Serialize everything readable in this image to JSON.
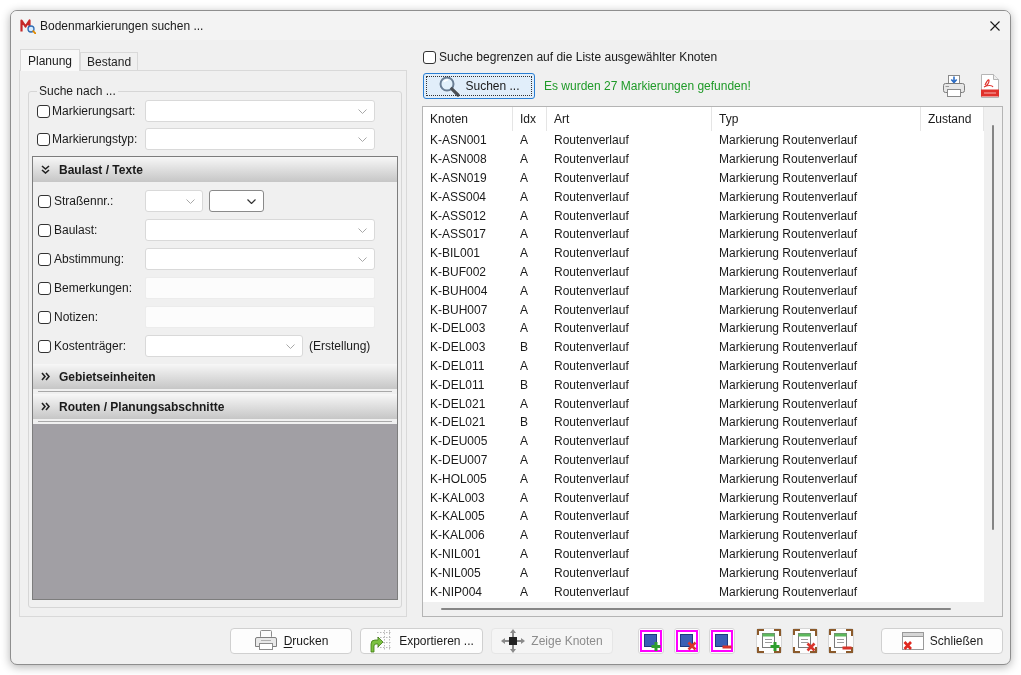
{
  "window": {
    "title": "Bodenmarkierungen suchen ..."
  },
  "tabs": [
    {
      "label": "Planung",
      "selected": true
    },
    {
      "label": "Bestand",
      "selected": false
    }
  ],
  "search_group": {
    "title": "Suche nach ...",
    "filters": [
      {
        "label": "Markierungsart:",
        "checked": false,
        "fields": [
          {
            "kind": "combo"
          }
        ]
      },
      {
        "label": "Markierungstyp:",
        "checked": false,
        "fields": [
          {
            "kind": "combo"
          }
        ]
      }
    ],
    "sections": [
      {
        "title": "Baulast / Texte",
        "expanded": true,
        "rows": [
          {
            "label": "Straßennr.:",
            "checked": false,
            "fields": [
              {
                "kind": "combo"
              },
              {
                "kind": "dropdown"
              }
            ]
          },
          {
            "label": "Baulast:",
            "checked": false,
            "fields": [
              {
                "kind": "combo"
              }
            ]
          },
          {
            "label": "Abstimmung:",
            "checked": false,
            "fields": [
              {
                "kind": "combo"
              }
            ]
          },
          {
            "label": "Bemerkungen:",
            "checked": false,
            "fields": [
              {
                "kind": "text"
              }
            ]
          },
          {
            "label": "Notizen:",
            "checked": false,
            "fields": [
              {
                "kind": "text"
              }
            ]
          },
          {
            "label": "Kostenträger:",
            "checked": false,
            "fields": [
              {
                "kind": "combo"
              }
            ],
            "note": "(Erstellung)"
          }
        ]
      },
      {
        "title": "Gebietseinheiten",
        "expanded": false
      },
      {
        "title": "Routen / Planungsabschnitte",
        "expanded": false
      }
    ]
  },
  "restrict_search": {
    "label": "Suche begrenzen auf die Liste ausgewählter Knoten",
    "checked": false
  },
  "search_button": {
    "label": "Suchen ...",
    "focused": true
  },
  "result_message": "Es wurden 27 Markierungen gefunden!",
  "table": {
    "columns": [
      "Knoten",
      "Idx",
      "Art",
      "Typ",
      "Zustand"
    ],
    "rows": [
      [
        "K-ASN001",
        "A",
        "Routenverlauf",
        "Markierung Routenverlauf"
      ],
      [
        "K-ASN008",
        "A",
        "Routenverlauf",
        "Markierung Routenverlauf"
      ],
      [
        "K-ASN019",
        "A",
        "Routenverlauf",
        "Markierung Routenverlauf"
      ],
      [
        "K-ASS004",
        "A",
        "Routenverlauf",
        "Markierung Routenverlauf"
      ],
      [
        "K-ASS012",
        "A",
        "Routenverlauf",
        "Markierung Routenverlauf"
      ],
      [
        "K-ASS017",
        "A",
        "Routenverlauf",
        "Markierung Routenverlauf"
      ],
      [
        "K-BIL001",
        "A",
        "Routenverlauf",
        "Markierung Routenverlauf"
      ],
      [
        "K-BUF002",
        "A",
        "Routenverlauf",
        "Markierung Routenverlauf"
      ],
      [
        "K-BUH004",
        "A",
        "Routenverlauf",
        "Markierung Routenverlauf"
      ],
      [
        "K-BUH007",
        "A",
        "Routenverlauf",
        "Markierung Routenverlauf"
      ],
      [
        "K-DEL003",
        "A",
        "Routenverlauf",
        "Markierung Routenverlauf"
      ],
      [
        "K-DEL003",
        "B",
        "Routenverlauf",
        "Markierung Routenverlauf"
      ],
      [
        "K-DEL011",
        "A",
        "Routenverlauf",
        "Markierung Routenverlauf"
      ],
      [
        "K-DEL011",
        "B",
        "Routenverlauf",
        "Markierung Routenverlauf"
      ],
      [
        "K-DEL021",
        "A",
        "Routenverlauf",
        "Markierung Routenverlauf"
      ],
      [
        "K-DEL021",
        "B",
        "Routenverlauf",
        "Markierung Routenverlauf"
      ],
      [
        "K-DEU005",
        "A",
        "Routenverlauf",
        "Markierung Routenverlauf"
      ],
      [
        "K-DEU007",
        "A",
        "Routenverlauf",
        "Markierung Routenverlauf"
      ],
      [
        "K-HOL005",
        "A",
        "Routenverlauf",
        "Markierung Routenverlauf"
      ],
      [
        "K-KAL003",
        "A",
        "Routenverlauf",
        "Markierung Routenverlauf"
      ],
      [
        "K-KAL005",
        "A",
        "Routenverlauf",
        "Markierung Routenverlauf"
      ],
      [
        "K-KAL006",
        "A",
        "Routenverlauf",
        "Markierung Routenverlauf"
      ],
      [
        "K-NIL001",
        "A",
        "Routenverlauf",
        "Markierung Routenverlauf"
      ],
      [
        "K-NIL005",
        "A",
        "Routenverlauf",
        "Markierung Routenverlauf"
      ],
      [
        "K-NIP004",
        "A",
        "Routenverlauf",
        "Markierung Routenverlauf"
      ]
    ]
  },
  "buttons": [
    {
      "label": "Drucken",
      "mnemonic_underlined": true,
      "disabled": false
    },
    {
      "label": "Exportieren ...",
      "disabled": false
    },
    {
      "label": "Zeige Knoten",
      "disabled": true
    }
  ],
  "close_button": {
    "label": "Schließen"
  }
}
